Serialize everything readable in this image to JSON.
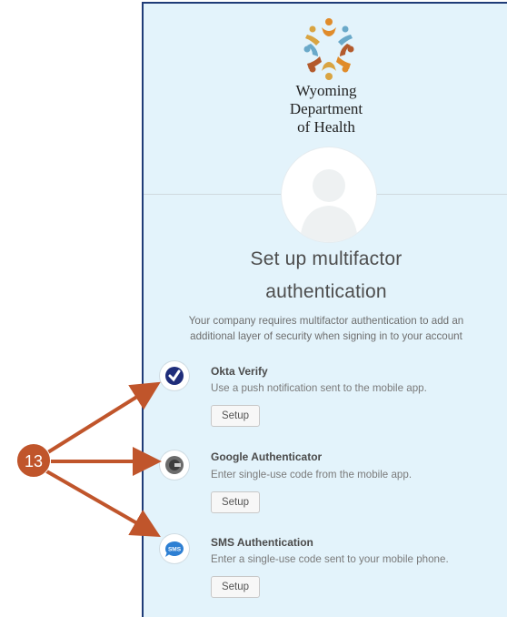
{
  "organization": {
    "line1": "Wyoming",
    "line2": "Department",
    "line3": "of Health"
  },
  "heading": {
    "line1": "Set up multifactor",
    "line2": "authentication"
  },
  "description": {
    "line1": "Your company requires multifactor authentication to add an",
    "line2": "additional layer of security when signing in to your account"
  },
  "factors": [
    {
      "name": "Okta Verify",
      "description": "Use a push notification sent to the mobile app.",
      "button_label": "Setup",
      "icon": "okta-verify-icon"
    },
    {
      "name": "Google Authenticator",
      "description": "Enter single-use code from the mobile app.",
      "button_label": "Setup",
      "icon": "google-authenticator-icon"
    },
    {
      "name": "SMS Authentication",
      "description": "Enter a single-use code sent to your mobile phone.",
      "button_label": "Setup",
      "icon": "sms-icon",
      "icon_text": "SMS"
    }
  ],
  "annotation": {
    "step_number": "13"
  },
  "colors": {
    "panel_background": "#e3f3fb",
    "panel_border": "#1f3c78",
    "annotation": "#c0552b",
    "okta_blue": "#1f2d7a",
    "sms_blue": "#2d7fd3"
  }
}
